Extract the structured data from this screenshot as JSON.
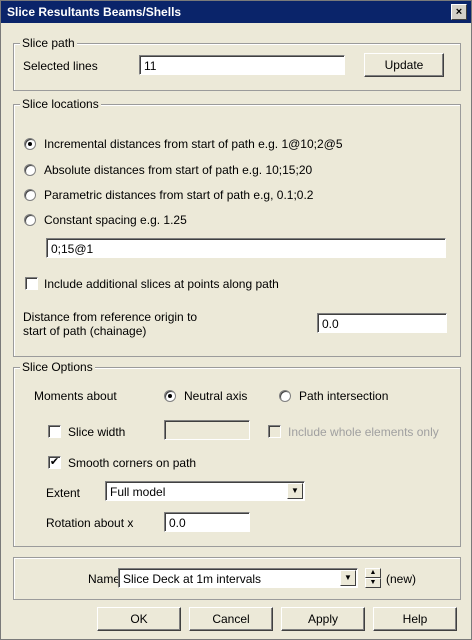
{
  "window": {
    "title": "Slice Resultants Beams/Shells",
    "close_glyph": "×"
  },
  "slice_path": {
    "legend": "Slice path",
    "selected_lines_label": "Selected lines",
    "selected_lines_value": "11",
    "update_label": "Update"
  },
  "slice_locations": {
    "legend": "Slice locations",
    "options": [
      {
        "label": "Incremental distances from start of path e.g. 1@10;2@5",
        "checked": true
      },
      {
        "label": "Absolute distances from start of path e.g. 10;15;20",
        "checked": false
      },
      {
        "label": "Parametric distances from start of path e.g, 0.1;0.2",
        "checked": false
      },
      {
        "label": "Constant spacing e.g. 1.25",
        "checked": false
      }
    ],
    "spacing_value": "0;15@1",
    "include_additional_label": "Include additional slices at points along path",
    "include_additional_checked": false,
    "distance_label_line1": "Distance from reference origin to",
    "distance_label_line2": "start of path (chainage)",
    "distance_value": "0.0"
  },
  "slice_options": {
    "legend": "Slice Options",
    "moments_label": "Moments about",
    "neutral_axis_label": "Neutral axis",
    "neutral_axis_checked": true,
    "path_intersection_label": "Path intersection",
    "path_intersection_checked": false,
    "slice_width_label": "Slice width",
    "slice_width_checked": false,
    "slice_width_value": "",
    "include_whole_label": "Include whole elements only",
    "smooth_corners_label": "Smooth corners on path",
    "smooth_corners_checked": true,
    "extent_label": "Extent",
    "extent_value": "Full model",
    "rotation_label": "Rotation about x",
    "rotation_value": "0.0"
  },
  "name_section": {
    "name_label": "Name",
    "name_value": "Slice Deck at 1m intervals",
    "new_label": "(new)"
  },
  "buttons": {
    "ok": "OK",
    "cancel": "Cancel",
    "apply": "Apply",
    "help": "Help"
  },
  "icons": {
    "check_mark": "✔",
    "dropdown": "▼",
    "spin_up": "▲",
    "spin_down": "▼"
  }
}
